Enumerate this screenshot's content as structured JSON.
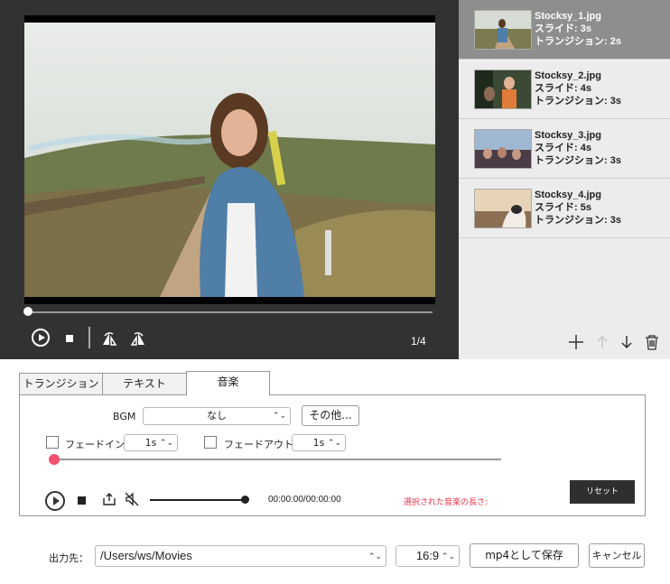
{
  "player": {
    "page_indicator": "1/4",
    "seek_progress": 0.0
  },
  "slides": [
    {
      "name": "Stocksy_1.jpg",
      "slide": "スライド: 3s",
      "transition": "トランジション: 2s",
      "selected": true
    },
    {
      "name": "Stocksy_2.jpg",
      "slide": "スライド: 4s",
      "transition": "トランジション: 3s",
      "selected": false
    },
    {
      "name": "Stocksy_3.jpg",
      "slide": "スライド: 4s",
      "transition": "トランジション: 3s",
      "selected": false
    },
    {
      "name": "Stocksy_4.jpg",
      "slide": "スライド: 5s",
      "transition": "トランジション: 3s",
      "selected": false
    }
  ],
  "tabs": {
    "transition": "トランジション",
    "text": "テキスト",
    "music": "音楽"
  },
  "music": {
    "bgm_label": "BGM",
    "bgm_value": "なし",
    "other_button": "その他...",
    "fade_in_label": "フェードイン",
    "fade_in_value": "1s",
    "fade_out_label": "フェードアウト",
    "fade_out_value": "1s",
    "time": "00:00:00/00:00:00",
    "length_label": "選択された音楽の長さ:",
    "reset_button": "リセット",
    "playback_progress": 1.0
  },
  "output": {
    "label": "出力先：",
    "path": "/Users/ws/Movies",
    "aspect": "16:9",
    "save_button": "mp4として保存",
    "cancel_button": "キャンセル"
  },
  "colors": {
    "player_bg": "#323232",
    "selected_slide": "#8e8e8e",
    "accent_red": "#f0506e"
  }
}
